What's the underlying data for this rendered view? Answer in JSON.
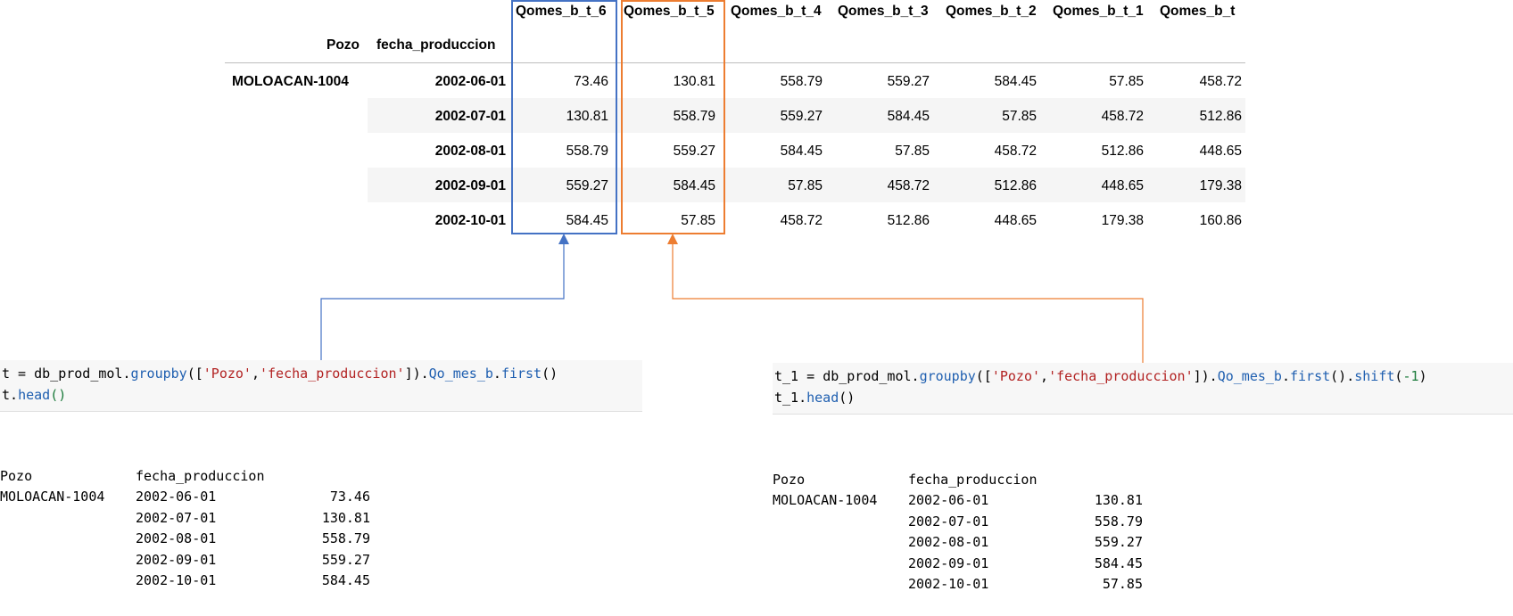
{
  "dataframe": {
    "index_headers": [
      "Pozo",
      "fecha_produccion"
    ],
    "columns": [
      "Qomes_b_t_6",
      "Qomes_b_t_5",
      "Qomes_b_t_4",
      "Qomes_b_t_3",
      "Qomes_b_t_2",
      "Qomes_b_t_1",
      "Qomes_b_t"
    ],
    "pozo": "MOLOACAN-1004",
    "rows": [
      {
        "fecha": "2002-06-01",
        "values": [
          "73.46",
          "130.81",
          "558.79",
          "559.27",
          "584.45",
          "57.85",
          "458.72"
        ]
      },
      {
        "fecha": "2002-07-01",
        "values": [
          "130.81",
          "558.79",
          "559.27",
          "584.45",
          "57.85",
          "458.72",
          "512.86"
        ]
      },
      {
        "fecha": "2002-08-01",
        "values": [
          "558.79",
          "559.27",
          "584.45",
          "57.85",
          "458.72",
          "512.86",
          "448.65"
        ]
      },
      {
        "fecha": "2002-09-01",
        "values": [
          "559.27",
          "584.45",
          "57.85",
          "458.72",
          "512.86",
          "448.65",
          "179.38"
        ]
      },
      {
        "fecha": "2002-10-01",
        "values": [
          "584.45",
          "57.85",
          "458.72",
          "512.86",
          "448.65",
          "179.38",
          "160.86"
        ]
      }
    ]
  },
  "colors": {
    "highlight_blue": "#4472c4",
    "highlight_orange": "#ed7d31",
    "band": "#f5f5f5"
  },
  "left_cell": {
    "line1": {
      "var": "t",
      "eq": " = ",
      "obj": "db_prod_mol.",
      "method1": "groupby",
      "p1": "([",
      "s1": "'Pozo'",
      "comma": ",",
      "s2": "'fecha_produccion'",
      "p2": "]).",
      "attr": "Qo_mes_b",
      "dot": ".",
      "method2": "first",
      "p3": "()"
    },
    "line2": {
      "var": "t.",
      "method": "head",
      "paren": "()"
    },
    "output": {
      "header_pozo": "Pozo",
      "header_fecha": "fecha_produccion",
      "pozo": "MOLOACAN-1004",
      "dates": [
        "2002-06-01",
        "2002-07-01",
        "2002-08-01",
        "2002-09-01",
        "2002-10-01"
      ],
      "values": [
        "73.46",
        "130.81",
        "558.79",
        "559.27",
        "584.45"
      ]
    }
  },
  "right_cell": {
    "line1": {
      "var": "t_1",
      "eq": " = ",
      "obj": "db_prod_mol.",
      "method1": "groupby",
      "p1": "([",
      "s1": "'Pozo'",
      "comma": ",",
      "s2": "'fecha_produccion'",
      "p2": "]).",
      "attr": "Qo_mes_b",
      "dot": ".",
      "method2": "first",
      "p3": "().",
      "method3": "shift",
      "p4": "(",
      "num": "-1",
      "p5": ")"
    },
    "line2": {
      "var": "t_1.",
      "method": "head",
      "paren": "()"
    },
    "output": {
      "header_pozo": "Pozo",
      "header_fecha": "fecha_produccion",
      "pozo": "MOLOACAN-1004",
      "dates": [
        "2002-06-01",
        "2002-07-01",
        "2002-08-01",
        "2002-09-01",
        "2002-10-01"
      ],
      "values": [
        "130.81",
        "558.79",
        "559.27",
        "584.45",
        "57.85"
      ]
    }
  }
}
